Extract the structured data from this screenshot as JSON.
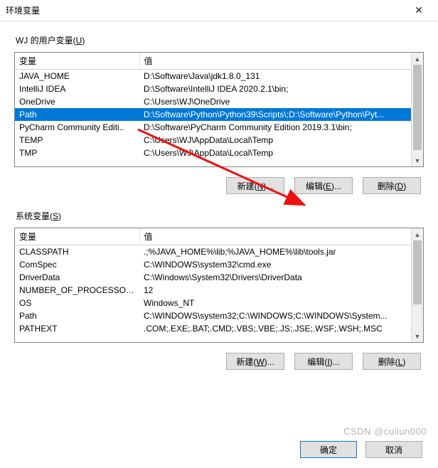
{
  "window": {
    "title": "环境变量",
    "close": "✕"
  },
  "user_section": {
    "label_prefix": "WJ 的用户变量(",
    "label_key": "U",
    "label_suffix": ")",
    "col_name": "变量",
    "col_value": "值",
    "rows": [
      {
        "name": "JAVA_HOME",
        "value": "D:\\Software\\Java\\jdk1.8.0_131"
      },
      {
        "name": "IntelliJ IDEA",
        "value": "D:\\Software\\IntelliJ IDEA 2020.2.1\\bin;"
      },
      {
        "name": "OneDrive",
        "value": "C:\\Users\\WJ\\OneDrive"
      },
      {
        "name": "Path",
        "value": "D:\\Software\\Python\\Python39\\Scripts\\;D:\\Software\\Python\\Pyt..."
      },
      {
        "name": "PyCharm Community Editi..",
        "value": "D:\\Software\\PyCharm Community Edition 2019.3.1\\bin;"
      },
      {
        "name": "TEMP",
        "value": "C:\\Users\\WJ\\AppData\\Local\\Temp"
      },
      {
        "name": "TMP",
        "value": "C:\\Users\\WJ\\AppData\\Local\\Temp"
      }
    ],
    "buttons": {
      "new": "新建(N)...",
      "edit": "编辑(E)...",
      "delete": "删除(D)"
    },
    "selected_index": 3
  },
  "sys_section": {
    "label_prefix": "系统变量(",
    "label_key": "S",
    "label_suffix": ")",
    "col_name": "变量",
    "col_value": "值",
    "rows": [
      {
        "name": "CLASSPATH",
        "value": ".;%JAVA_HOME%\\lib;%JAVA_HOME%\\lib\\tools.jar"
      },
      {
        "name": "ComSpec",
        "value": "C:\\WINDOWS\\system32\\cmd.exe"
      },
      {
        "name": "DriverData",
        "value": "C:\\Windows\\System32\\Drivers\\DriverData"
      },
      {
        "name": "NUMBER_OF_PROCESSORS",
        "value": "12"
      },
      {
        "name": "OS",
        "value": "Windows_NT"
      },
      {
        "name": "Path",
        "value": "C:\\WINDOWS\\system32;C:\\WINDOWS;C:\\WINDOWS\\System..."
      },
      {
        "name": "PATHEXT",
        "value": ".COM;.EXE;.BAT;.CMD;.VBS;.VBE;.JS;.JSE;.WSF;.WSH;.MSC"
      }
    ],
    "buttons": {
      "new": "新建(W)...",
      "edit": "编辑(I)...",
      "delete": "删除(L)"
    },
    "selected_index": -1
  },
  "dialog": {
    "ok": "确定",
    "cancel": "取消"
  },
  "watermark": "CSDN @cuilun000"
}
